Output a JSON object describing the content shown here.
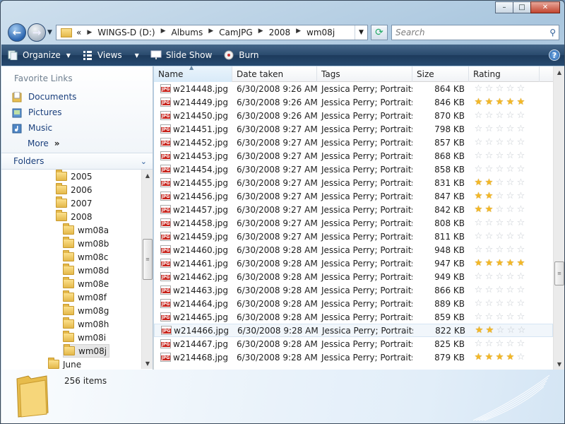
{
  "window": {
    "minimize_label": "–",
    "maximize_label": "□",
    "close_label": "✕"
  },
  "address": {
    "prefix": "«",
    "crumbs": [
      "WINGS-D (D:)",
      "Albums",
      "CamJPG",
      "2008",
      "wm08j"
    ]
  },
  "search": {
    "placeholder": "Search"
  },
  "toolbar": {
    "organize": "Organize",
    "views": "Views",
    "slideshow": "Slide Show",
    "burn": "Burn",
    "help": "?"
  },
  "favorites": {
    "title": "Favorite Links",
    "items": [
      "Documents",
      "Pictures",
      "Music"
    ],
    "more": "More",
    "more_chevron": "»"
  },
  "folders": {
    "title": "Folders",
    "tree": [
      {
        "label": "2005",
        "level": 1
      },
      {
        "label": "2006",
        "level": 1
      },
      {
        "label": "2007",
        "level": 1
      },
      {
        "label": "2008",
        "level": 1
      },
      {
        "label": "wm08a",
        "level": 2
      },
      {
        "label": "wm08b",
        "level": 2
      },
      {
        "label": "wm08c",
        "level": 2
      },
      {
        "label": "wm08d",
        "level": 2
      },
      {
        "label": "wm08e",
        "level": 2
      },
      {
        "label": "wm08f",
        "level": 2
      },
      {
        "label": "wm08g",
        "level": 2
      },
      {
        "label": "wm08h",
        "level": 2
      },
      {
        "label": "wm08i",
        "level": 2
      },
      {
        "label": "wm08j",
        "level": 2,
        "selected": true
      },
      {
        "label": "June",
        "level": 0
      }
    ]
  },
  "columns": {
    "name": "Name",
    "date": "Date taken",
    "tags": "Tags",
    "size": "Size",
    "rating": "Rating"
  },
  "file_icon_label": "JPG",
  "files": [
    {
      "name": "w214448.jpg",
      "date": "6/30/2008 9:26 AM",
      "tags": "Jessica Perry; Portraits",
      "size": "864 KB",
      "rating": 0
    },
    {
      "name": "w214449.jpg",
      "date": "6/30/2008 9:26 AM",
      "tags": "Jessica Perry; Portraits",
      "size": "846 KB",
      "rating": 5
    },
    {
      "name": "w214450.jpg",
      "date": "6/30/2008 9:26 AM",
      "tags": "Jessica Perry; Portraits",
      "size": "870 KB",
      "rating": 0
    },
    {
      "name": "w214451.jpg",
      "date": "6/30/2008 9:27 AM",
      "tags": "Jessica Perry; Portraits",
      "size": "798 KB",
      "rating": 0
    },
    {
      "name": "w214452.jpg",
      "date": "6/30/2008 9:27 AM",
      "tags": "Jessica Perry; Portraits",
      "size": "857 KB",
      "rating": 0
    },
    {
      "name": "w214453.jpg",
      "date": "6/30/2008 9:27 AM",
      "tags": "Jessica Perry; Portraits",
      "size": "868 KB",
      "rating": 0
    },
    {
      "name": "w214454.jpg",
      "date": "6/30/2008 9:27 AM",
      "tags": "Jessica Perry; Portraits",
      "size": "858 KB",
      "rating": 0
    },
    {
      "name": "w214455.jpg",
      "date": "6/30/2008 9:27 AM",
      "tags": "Jessica Perry; Portraits",
      "size": "831 KB",
      "rating": 2
    },
    {
      "name": "w214456.jpg",
      "date": "6/30/2008 9:27 AM",
      "tags": "Jessica Perry; Portraits",
      "size": "847 KB",
      "rating": 2
    },
    {
      "name": "w214457.jpg",
      "date": "6/30/2008 9:27 AM",
      "tags": "Jessica Perry; Portraits",
      "size": "842 KB",
      "rating": 2
    },
    {
      "name": "w214458.jpg",
      "date": "6/30/2008 9:27 AM",
      "tags": "Jessica Perry; Portraits",
      "size": "808 KB",
      "rating": 0
    },
    {
      "name": "w214459.jpg",
      "date": "6/30/2008 9:27 AM",
      "tags": "Jessica Perry; Portraits",
      "size": "811 KB",
      "rating": 0
    },
    {
      "name": "w214460.jpg",
      "date": "6/30/2008 9:28 AM",
      "tags": "Jessica Perry; Portraits",
      "size": "948 KB",
      "rating": 0
    },
    {
      "name": "w214461.jpg",
      "date": "6/30/2008 9:28 AM",
      "tags": "Jessica Perry; Portraits",
      "size": "947 KB",
      "rating": 5
    },
    {
      "name": "w214462.jpg",
      "date": "6/30/2008 9:28 AM",
      "tags": "Jessica Perry; Portraits",
      "size": "949 KB",
      "rating": 0
    },
    {
      "name": "w214463.jpg",
      "date": "6/30/2008 9:28 AM",
      "tags": "Jessica Perry; Portraits",
      "size": "866 KB",
      "rating": 0
    },
    {
      "name": "w214464.jpg",
      "date": "6/30/2008 9:28 AM",
      "tags": "Jessica Perry; Portraits",
      "size": "889 KB",
      "rating": 0
    },
    {
      "name": "w214465.jpg",
      "date": "6/30/2008 9:28 AM",
      "tags": "Jessica Perry; Portraits",
      "size": "859 KB",
      "rating": 0
    },
    {
      "name": "w214466.jpg",
      "date": "6/30/2008 9:28 AM",
      "tags": "Jessica Perry; Portraits",
      "size": "822 KB",
      "rating": 2,
      "hover": true
    },
    {
      "name": "w214467.jpg",
      "date": "6/30/2008 9:28 AM",
      "tags": "Jessica Perry; Portraits",
      "size": "825 KB",
      "rating": 0
    },
    {
      "name": "w214468.jpg",
      "date": "6/30/2008 9:28 AM",
      "tags": "Jessica Perry; Portraits",
      "size": "879 KB",
      "rating": 4
    }
  ],
  "status": {
    "item_count": "256 items"
  },
  "colors": {
    "toolbar": "#274a70",
    "link": "#1a3f7c",
    "star_on": "#f4b825",
    "star_off": "#dcdfe3"
  }
}
